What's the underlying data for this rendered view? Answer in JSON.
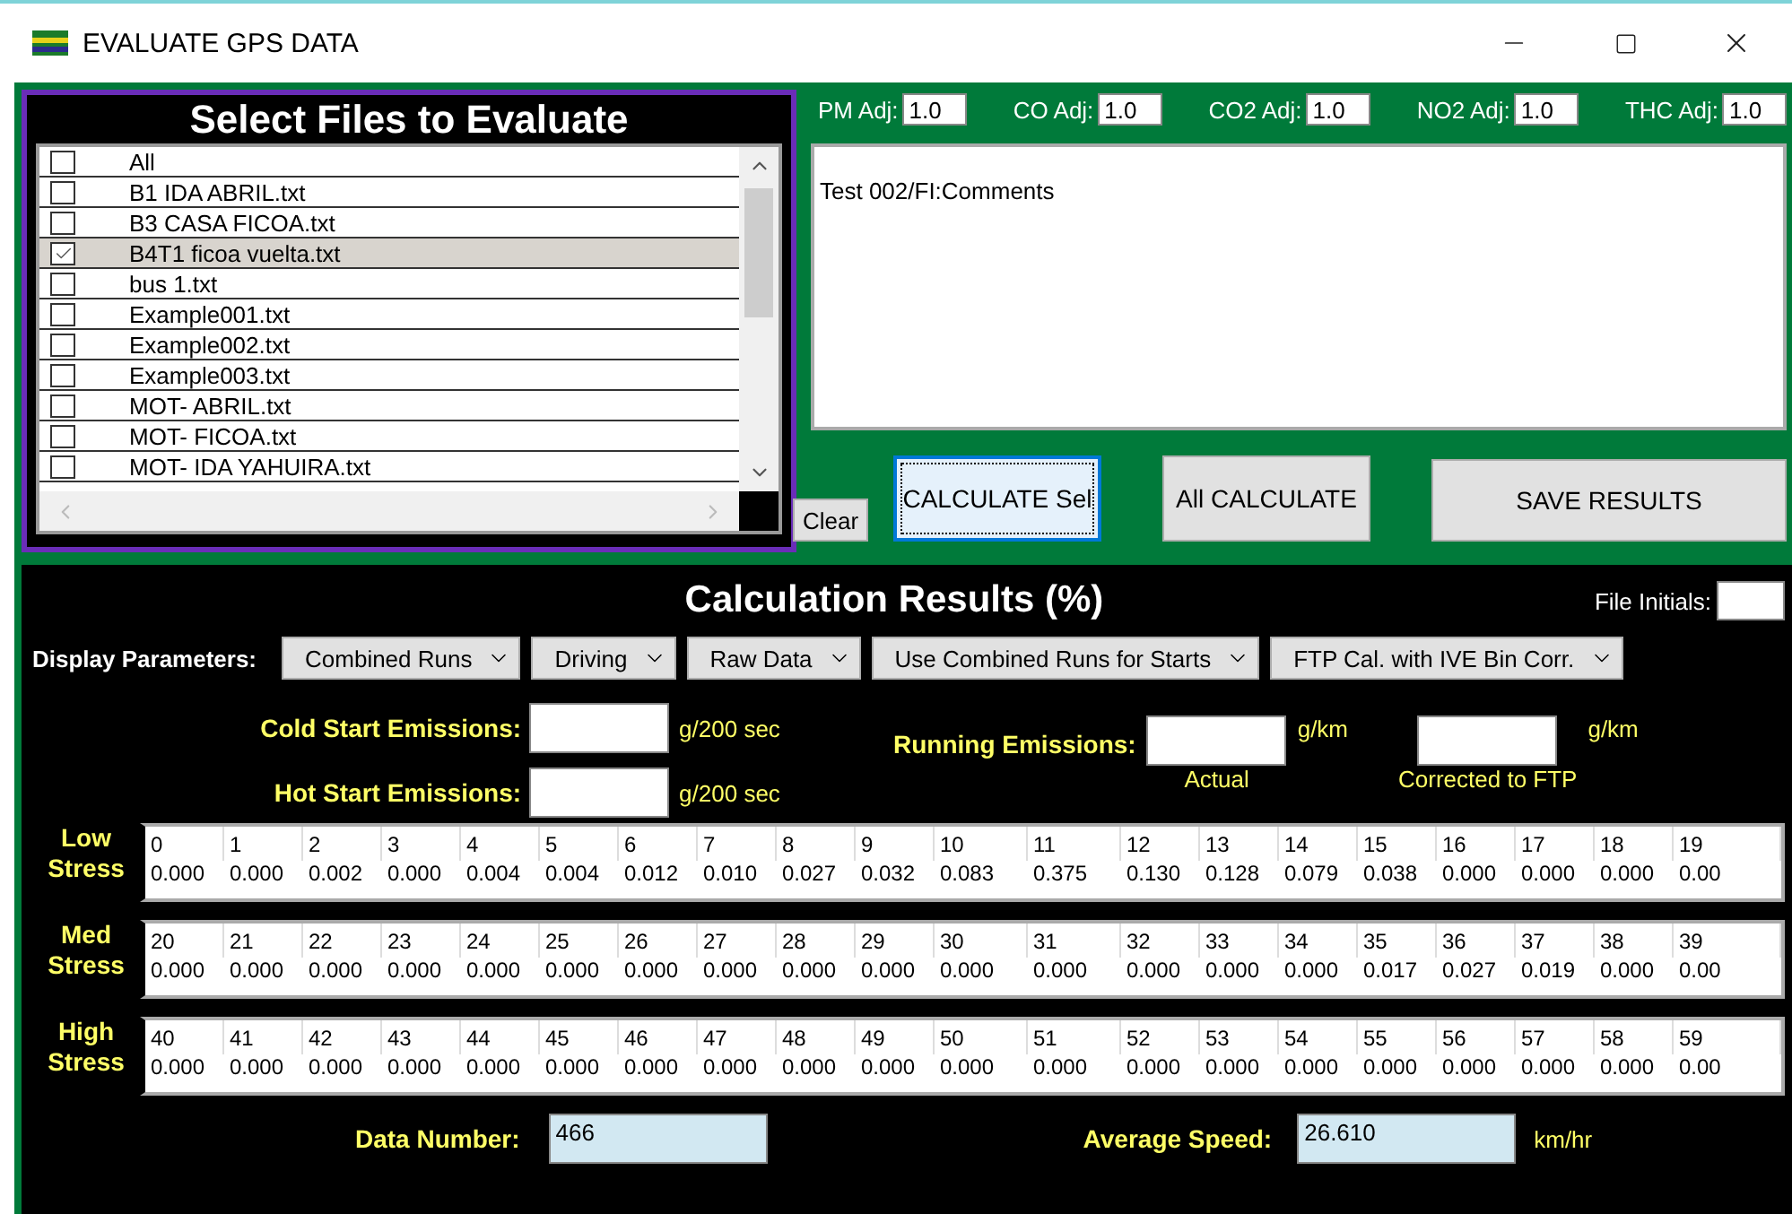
{
  "window": {
    "title": "EVALUATE GPS DATA"
  },
  "file_panel": {
    "title": "Select Files to Evaluate",
    "items": [
      {
        "label": "All",
        "checked": false,
        "selected": false
      },
      {
        "label": "B1 IDA ABRIL.txt",
        "checked": false,
        "selected": false
      },
      {
        "label": "B3 CASA FICOA.txt",
        "checked": false,
        "selected": false
      },
      {
        "label": "B4T1 ficoa vuelta.txt",
        "checked": true,
        "selected": true
      },
      {
        "label": "bus 1.txt",
        "checked": false,
        "selected": false
      },
      {
        "label": "Example001.txt",
        "checked": false,
        "selected": false
      },
      {
        "label": "Example002.txt",
        "checked": false,
        "selected": false
      },
      {
        "label": "Example003.txt",
        "checked": false,
        "selected": false
      },
      {
        "label": "MOT- ABRIL.txt",
        "checked": false,
        "selected": false
      },
      {
        "label": "MOT- FICOA.txt",
        "checked": false,
        "selected": false
      },
      {
        "label": "MOT- IDA YAHUIRA.txt",
        "checked": false,
        "selected": false
      }
    ]
  },
  "adjustments": [
    {
      "label": "PM Adj:",
      "value": "1.0"
    },
    {
      "label": "CO Adj:",
      "value": "1.0"
    },
    {
      "label": "CO2 Adj:",
      "value": "1.0"
    },
    {
      "label": "NO2 Adj:",
      "value": "1.0"
    },
    {
      "label": "THC Adj:",
      "value": "1.0"
    }
  ],
  "comments": {
    "value": "Test 002/FI:Comments"
  },
  "buttons": [
    {
      "label": "Clear",
      "kind": "small",
      "focused": false
    },
    {
      "label": "CALCULATE Sel",
      "kind": "medium",
      "focused": true
    },
    {
      "label": "All CALCULATE",
      "kind": "medium",
      "focused": false
    },
    {
      "label": "SAVE RESULTS",
      "kind": "large",
      "focused": false
    }
  ],
  "results": {
    "title": "Calculation Results (%)",
    "file_initials_label": "File Initials:",
    "display_label": "Display Parameters:",
    "dropdowns": [
      "Combined Runs",
      "Driving",
      "Raw Data",
      "Use Combined Runs for Starts",
      "FTP Cal. with IVE Bin Corr."
    ],
    "cold_start": {
      "label": "Cold Start Emissions:",
      "unit": "g/200 sec"
    },
    "hot_start": {
      "label": "Hot Start Emissions:",
      "unit": "g/200 sec"
    },
    "running": {
      "label": "Running Emissions:",
      "unit_actual": "g/km",
      "caption_actual": "Actual",
      "unit_corrected": "g/km",
      "caption_corrected": "Corrected to FTP"
    },
    "stress_rows": [
      {
        "label": "Low Stress",
        "cells": [
          {
            "bin": "0",
            "value": "0.000"
          },
          {
            "bin": "1",
            "value": "0.000"
          },
          {
            "bin": "2",
            "value": "0.002"
          },
          {
            "bin": "3",
            "value": "0.000"
          },
          {
            "bin": "4",
            "value": "0.004"
          },
          {
            "bin": "5",
            "value": "0.004"
          },
          {
            "bin": "6",
            "value": "0.012"
          },
          {
            "bin": "7",
            "value": "0.010"
          },
          {
            "bin": "8",
            "value": "0.027"
          },
          {
            "bin": "9",
            "value": "0.032"
          },
          {
            "bin": "10",
            "value": "0.083"
          },
          {
            "bin": "11",
            "value": "0.375"
          },
          {
            "bin": "12",
            "value": "0.130"
          },
          {
            "bin": "13",
            "value": "0.128"
          },
          {
            "bin": "14",
            "value": "0.079"
          },
          {
            "bin": "15",
            "value": "0.038"
          },
          {
            "bin": "16",
            "value": "0.000"
          },
          {
            "bin": "17",
            "value": "0.000"
          },
          {
            "bin": "18",
            "value": "0.000"
          },
          {
            "bin": "19",
            "value": "0.00"
          }
        ]
      },
      {
        "label": "Med Stress",
        "cells": [
          {
            "bin": "20",
            "value": "0.000"
          },
          {
            "bin": "21",
            "value": "0.000"
          },
          {
            "bin": "22",
            "value": "0.000"
          },
          {
            "bin": "23",
            "value": "0.000"
          },
          {
            "bin": "24",
            "value": "0.000"
          },
          {
            "bin": "25",
            "value": "0.000"
          },
          {
            "bin": "26",
            "value": "0.000"
          },
          {
            "bin": "27",
            "value": "0.000"
          },
          {
            "bin": "28",
            "value": "0.000"
          },
          {
            "bin": "29",
            "value": "0.000"
          },
          {
            "bin": "30",
            "value": "0.000"
          },
          {
            "bin": "31",
            "value": "0.000"
          },
          {
            "bin": "32",
            "value": "0.000"
          },
          {
            "bin": "33",
            "value": "0.000"
          },
          {
            "bin": "34",
            "value": "0.000"
          },
          {
            "bin": "35",
            "value": "0.017"
          },
          {
            "bin": "36",
            "value": "0.027"
          },
          {
            "bin": "37",
            "value": "0.019"
          },
          {
            "bin": "38",
            "value": "0.000"
          },
          {
            "bin": "39",
            "value": "0.00"
          }
        ]
      },
      {
        "label": "High Stress",
        "cells": [
          {
            "bin": "40",
            "value": "0.000"
          },
          {
            "bin": "41",
            "value": "0.000"
          },
          {
            "bin": "42",
            "value": "0.000"
          },
          {
            "bin": "43",
            "value": "0.000"
          },
          {
            "bin": "44",
            "value": "0.000"
          },
          {
            "bin": "45",
            "value": "0.000"
          },
          {
            "bin": "46",
            "value": "0.000"
          },
          {
            "bin": "47",
            "value": "0.000"
          },
          {
            "bin": "48",
            "value": "0.000"
          },
          {
            "bin": "49",
            "value": "0.000"
          },
          {
            "bin": "50",
            "value": "0.000"
          },
          {
            "bin": "51",
            "value": "0.000"
          },
          {
            "bin": "52",
            "value": "0.000"
          },
          {
            "bin": "53",
            "value": "0.000"
          },
          {
            "bin": "54",
            "value": "0.000"
          },
          {
            "bin": "55",
            "value": "0.000"
          },
          {
            "bin": "56",
            "value": "0.000"
          },
          {
            "bin": "57",
            "value": "0.000"
          },
          {
            "bin": "58",
            "value": "0.000"
          },
          {
            "bin": "59",
            "value": "0.00"
          }
        ]
      }
    ],
    "data_number": {
      "label": "Data Number:",
      "value": "466"
    },
    "average_speed": {
      "label": "Average Speed:",
      "value": "26.610",
      "unit": "km/hr"
    }
  }
}
